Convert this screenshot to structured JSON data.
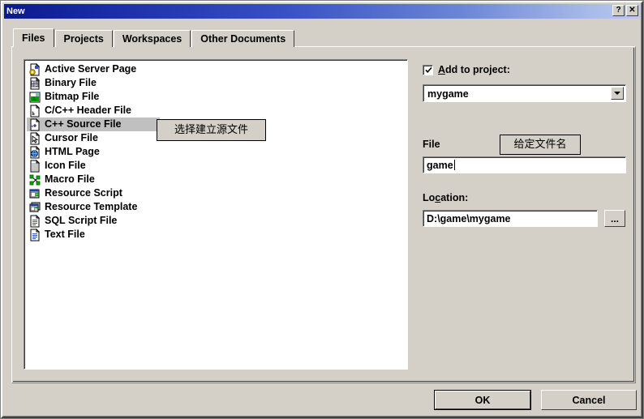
{
  "window": {
    "title": "New",
    "help_button": "?",
    "close_button": "✕"
  },
  "tabs": [
    {
      "label": "Files",
      "active": true
    },
    {
      "label": "Projects",
      "active": false
    },
    {
      "label": "Workspaces",
      "active": false
    },
    {
      "label": "Other Documents",
      "active": false
    }
  ],
  "file_list": {
    "selected": "C++ Source File",
    "items": [
      {
        "label": "Active Server Page",
        "icon": "active-server-page-icon"
      },
      {
        "label": "Binary File",
        "icon": "binary-file-icon"
      },
      {
        "label": "Bitmap File",
        "icon": "bitmap-file-icon"
      },
      {
        "label": "C/C++ Header File",
        "icon": "header-file-icon"
      },
      {
        "label": "C++ Source File",
        "icon": "cpp-source-file-icon"
      },
      {
        "label": "Cursor File",
        "icon": "cursor-file-icon"
      },
      {
        "label": "HTML Page",
        "icon": "html-page-icon"
      },
      {
        "label": "Icon File",
        "icon": "icon-file-icon"
      },
      {
        "label": "Macro File",
        "icon": "macro-file-icon"
      },
      {
        "label": "Resource Script",
        "icon": "resource-script-icon"
      },
      {
        "label": "Resource Template",
        "icon": "resource-template-icon"
      },
      {
        "label": "SQL Script File",
        "icon": "sql-script-file-icon"
      },
      {
        "label": "Text File",
        "icon": "text-file-icon"
      }
    ]
  },
  "annotations": {
    "list_callout": "选择建立源文件",
    "file_callout": "给定文件名"
  },
  "side_panel": {
    "add_to_project": {
      "label_prefix": "",
      "label_accel": "A",
      "label_rest": "dd to project:",
      "checked": true,
      "checkmark": "✔"
    },
    "project_combo": {
      "value": "mygame",
      "arrow": "▼"
    },
    "file": {
      "label": "File",
      "value": "game"
    },
    "location": {
      "label_prefix": "Lo",
      "label_accel": "c",
      "label_rest": "ation:",
      "value": "D:\\game\\mygame",
      "browse_label": "..."
    }
  },
  "buttons": {
    "ok": "OK",
    "cancel": "Cancel"
  },
  "colors": {
    "face": "#d4d0c8",
    "title_start": "#0a1a8c",
    "title_end": "#bcc9ee",
    "selection": "#c0c0c0",
    "text": "#000000"
  }
}
